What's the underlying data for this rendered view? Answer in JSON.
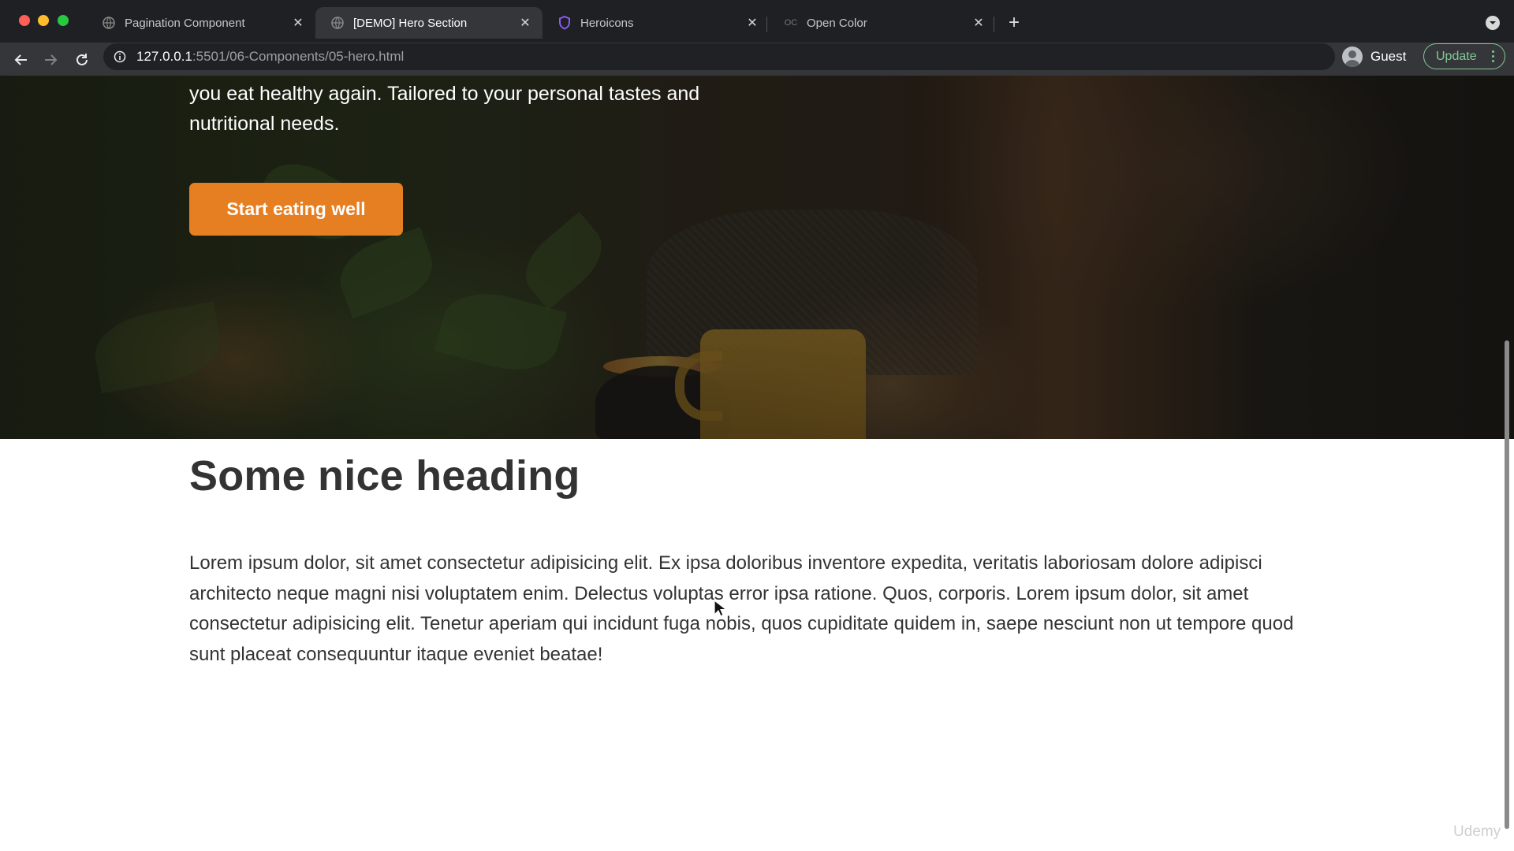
{
  "browser": {
    "tabs": [
      {
        "title": "Pagination Component",
        "active": false,
        "icon": "globe-icon"
      },
      {
        "title": "[DEMO] Hero Section",
        "active": true,
        "icon": "globe-icon"
      },
      {
        "title": "Heroicons",
        "active": false,
        "icon": "heroicons-shield-icon"
      },
      {
        "title": "Open Color",
        "active": false,
        "icon": "oc-icon",
        "icon_text": "OC"
      }
    ],
    "url_host": "127.0.0.1",
    "url_rest": ":5501/06-Components/05-hero.html",
    "profile_label": "Guest",
    "update_label": "Update"
  },
  "hero": {
    "description": "you eat healthy again. Tailored to your personal tastes and nutritional needs.",
    "cta_label": "Start eating well"
  },
  "section": {
    "heading": "Some nice heading",
    "paragraph": "Lorem ipsum dolor, sit amet consectetur adipisicing elit. Ex ipsa doloribus inventore expedita, veritatis laboriosam dolore adipisci architecto neque magni nisi voluptatem enim. Delectus voluptas error ipsa ratione. Quos, corporis. Lorem ipsum dolor, sit amet consectetur adipisicing elit. Tenetur aperiam qui incidunt fuga nobis, quos cupiditate quidem in, saepe nesciunt non ut tempore quod sunt placeat consequuntur itaque eveniet beatae!"
  },
  "watermark": "Udemy",
  "colors": {
    "accent": "#e67e22",
    "heading_text": "#333333",
    "chrome_bg": "#1f2023",
    "toolbar_bg": "#35363a",
    "update_green": "#81c995"
  }
}
